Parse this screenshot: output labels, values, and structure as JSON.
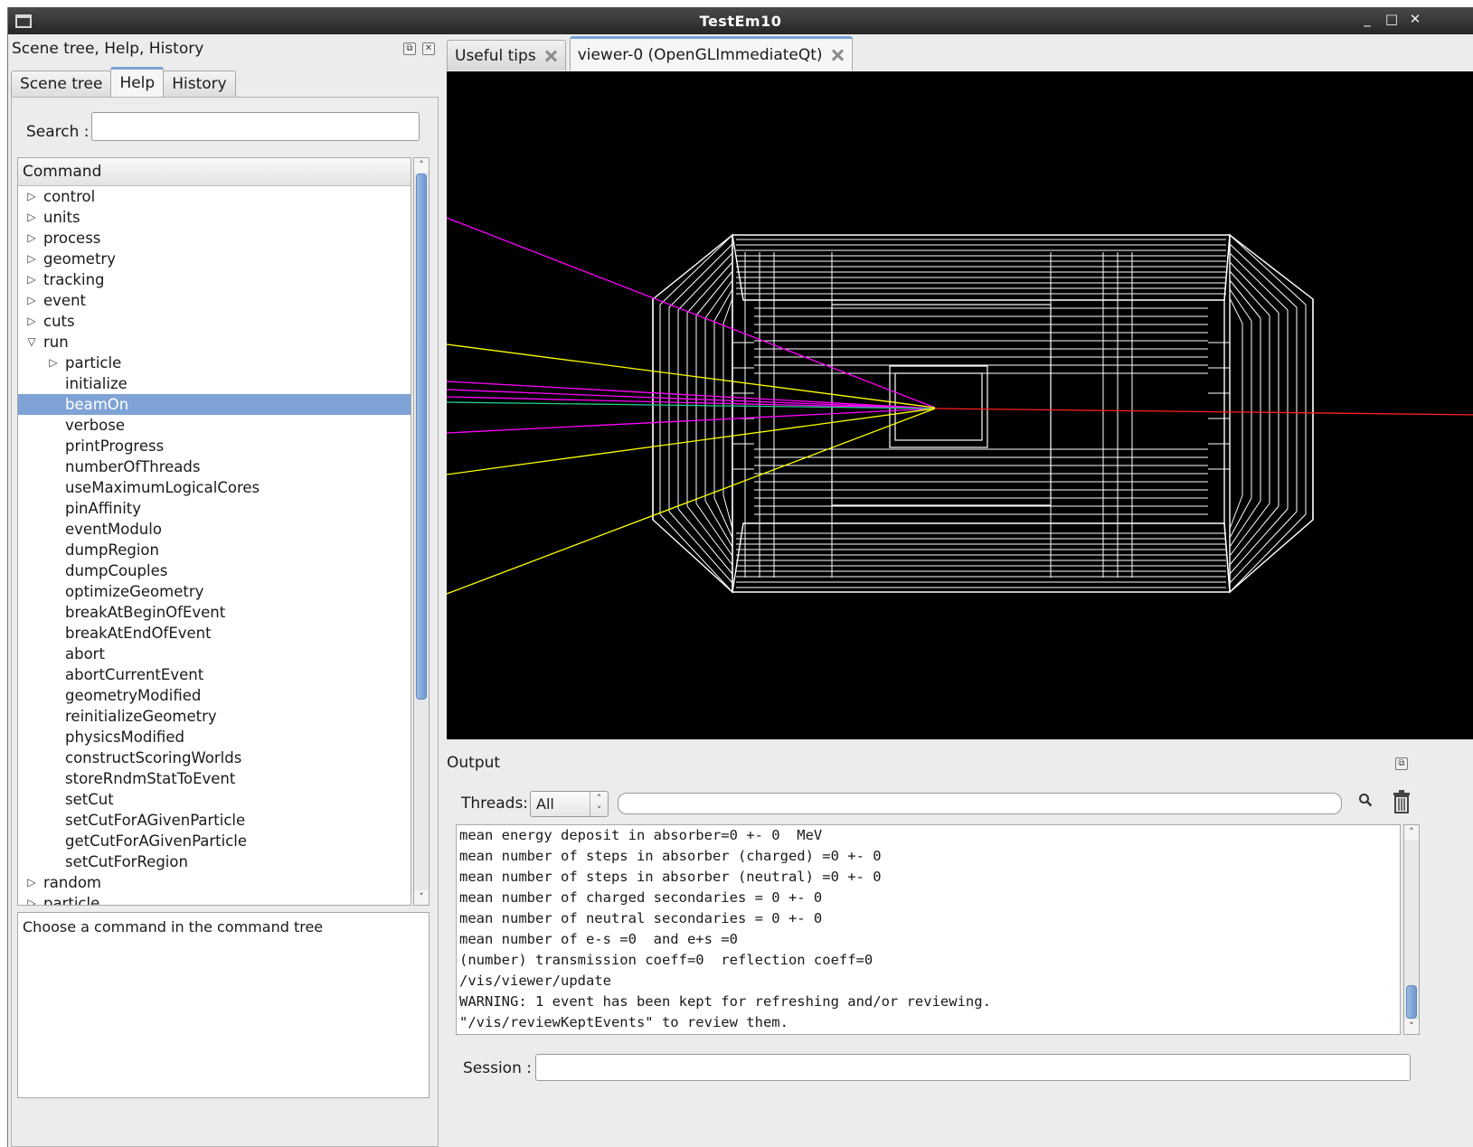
{
  "window": {
    "title": "TestEm10"
  },
  "left_dock": {
    "title": "Scene tree, Help, History",
    "tabs": [
      "Scene tree",
      "Help",
      "History"
    ],
    "active_tab": "Help",
    "search_label": "Search :",
    "search_value": "",
    "tree_header": "Command",
    "tree": [
      {
        "label": "control",
        "level": 0,
        "state": "collapsed"
      },
      {
        "label": "units",
        "level": 0,
        "state": "collapsed"
      },
      {
        "label": "process",
        "level": 0,
        "state": "collapsed"
      },
      {
        "label": "geometry",
        "level": 0,
        "state": "collapsed"
      },
      {
        "label": "tracking",
        "level": 0,
        "state": "collapsed"
      },
      {
        "label": "event",
        "level": 0,
        "state": "collapsed"
      },
      {
        "label": "cuts",
        "level": 0,
        "state": "collapsed"
      },
      {
        "label": "run",
        "level": 0,
        "state": "expanded"
      },
      {
        "label": "particle",
        "level": 1,
        "state": "collapsed"
      },
      {
        "label": "initialize",
        "level": 1,
        "state": "leaf"
      },
      {
        "label": "beamOn",
        "level": 1,
        "state": "leaf",
        "selected": true
      },
      {
        "label": "verbose",
        "level": 1,
        "state": "leaf"
      },
      {
        "label": "printProgress",
        "level": 1,
        "state": "leaf"
      },
      {
        "label": "numberOfThreads",
        "level": 1,
        "state": "leaf"
      },
      {
        "label": "useMaximumLogicalCores",
        "level": 1,
        "state": "leaf"
      },
      {
        "label": "pinAffinity",
        "level": 1,
        "state": "leaf"
      },
      {
        "label": "eventModulo",
        "level": 1,
        "state": "leaf"
      },
      {
        "label": "dumpRegion",
        "level": 1,
        "state": "leaf"
      },
      {
        "label": "dumpCouples",
        "level": 1,
        "state": "leaf"
      },
      {
        "label": "optimizeGeometry",
        "level": 1,
        "state": "leaf"
      },
      {
        "label": "breakAtBeginOfEvent",
        "level": 1,
        "state": "leaf"
      },
      {
        "label": "breakAtEndOfEvent",
        "level": 1,
        "state": "leaf"
      },
      {
        "label": "abort",
        "level": 1,
        "state": "leaf"
      },
      {
        "label": "abortCurrentEvent",
        "level": 1,
        "state": "leaf"
      },
      {
        "label": "geometryModified",
        "level": 1,
        "state": "leaf"
      },
      {
        "label": "reinitializeGeometry",
        "level": 1,
        "state": "leaf"
      },
      {
        "label": "physicsModified",
        "level": 1,
        "state": "leaf"
      },
      {
        "label": "constructScoringWorlds",
        "level": 1,
        "state": "leaf"
      },
      {
        "label": "storeRndmStatToEvent",
        "level": 1,
        "state": "leaf"
      },
      {
        "label": "setCut",
        "level": 1,
        "state": "leaf"
      },
      {
        "label": "setCutForAGivenParticle",
        "level": 1,
        "state": "leaf"
      },
      {
        "label": "getCutForAGivenParticle",
        "level": 1,
        "state": "leaf"
      },
      {
        "label": "setCutForRegion",
        "level": 1,
        "state": "leaf"
      },
      {
        "label": "random",
        "level": 0,
        "state": "collapsed"
      },
      {
        "label": "particle",
        "level": 0,
        "state": "collapsed"
      }
    ],
    "description": "Choose a command in the command tree"
  },
  "viewer_tabs": [
    {
      "label": "Useful tips",
      "active": false
    },
    {
      "label": "viewer-0 (OpenGLImmediateQt)",
      "active": true
    }
  ],
  "output": {
    "title": "Output",
    "threads_label": "Threads:",
    "threads_value": "All",
    "filter_value": "",
    "lines": [
      "mean energy deposit in absorber=0 +- 0  MeV",
      "mean number of steps in absorber (charged) =0 +- 0",
      "mean number of steps in absorber (neutral) =0 +- 0",
      "mean number of charged secondaries = 0 +- 0",
      "mean number of neutral secondaries = 0 +- 0",
      "mean number of e-s =0  and e+s =0",
      "(number) transmission coeff=0  reflection coeff=0",
      "/vis/viewer/update",
      "WARNING: 1 event has been kept for refreshing and/or reviewing.",
      "\"/vis/reviewKeptEvents\" to review them."
    ],
    "session_label": "Session :",
    "session_value": ""
  },
  "colors": {
    "selection": "#7fa3d6",
    "tab_accent": "#78a3d6",
    "viewer_bg": "#000000",
    "detector": "#ffffff",
    "track_gamma": "#ffff00",
    "track_negative": "#ff00ff",
    "track_primary": "#ff0000"
  }
}
